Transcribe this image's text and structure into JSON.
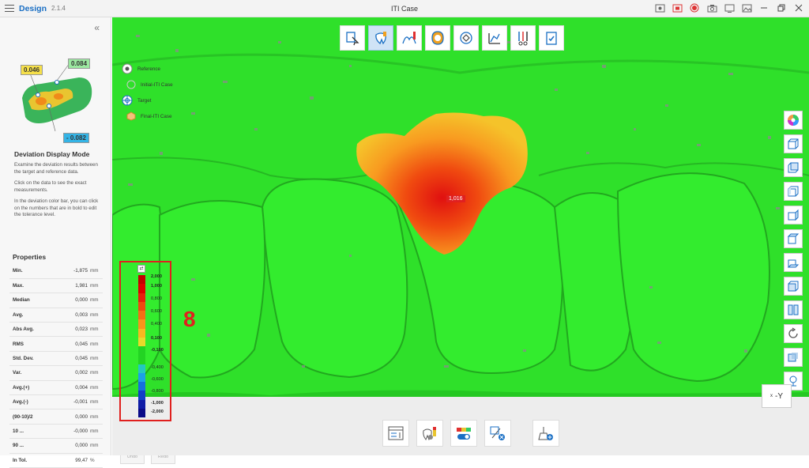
{
  "app": {
    "name": "Design",
    "version": "2.1.4",
    "window_title": "ITI Case"
  },
  "titlebar_icons": [
    "capture-icon",
    "record-frame-icon",
    "record-icon",
    "camera-icon",
    "screen-icon",
    "image-icon",
    "minimize-icon",
    "restore-icon",
    "close-icon"
  ],
  "thumbnail": {
    "tags": [
      "0.046",
      "0.084",
      "- 0.082"
    ]
  },
  "mode": {
    "title": "Deviation Display Mode",
    "paragraphs": [
      "Examine the deviation results between the target and reference data.",
      "Click on the data to see the exact measurements.",
      "In the deviation color bar, you can click on the numbers that are in bold to edit the tolerance level."
    ]
  },
  "properties": {
    "title": "Properties",
    "rows": [
      {
        "key": "Min.",
        "value": "-1,875",
        "unit": "mm"
      },
      {
        "key": "Max.",
        "value": "1,981",
        "unit": "mm"
      },
      {
        "key": "Median",
        "value": "0,000",
        "unit": "mm"
      },
      {
        "key": "Avg.",
        "value": "0,003",
        "unit": "mm"
      },
      {
        "key": "Abs Avg.",
        "value": "0,023",
        "unit": "mm"
      },
      {
        "key": "RMS",
        "value": "0,045",
        "unit": "mm"
      },
      {
        "key": "Std. Dev.",
        "value": "0,045",
        "unit": "mm"
      },
      {
        "key": "Var.",
        "value": "0,002",
        "unit": "mm"
      },
      {
        "key": "Avg.(+)",
        "value": "0,004",
        "unit": "mm"
      },
      {
        "key": "Avg.(-)",
        "value": "-0,001",
        "unit": "mm"
      },
      {
        "key": "(90-10)/2",
        "value": "0,000",
        "unit": "mm"
      },
      {
        "key": "10 ...",
        "value": "-0,000",
        "unit": "mm"
      },
      {
        "key": "90 ...",
        "value": "0,000",
        "unit": "mm"
      },
      {
        "key": "In Tol.",
        "value": "99,47",
        "unit": "%"
      }
    ]
  },
  "history": {
    "undo": "Undo",
    "redo": "Redo"
  },
  "legend": {
    "reference_label": "Reference",
    "reference_item": "Initial-ITI Case",
    "target_label": "Target",
    "target_item": "Final-ITI Case"
  },
  "colorbar": {
    "labels": [
      {
        "text": "2,000",
        "bold": true
      },
      {
        "text": "1,000",
        "bold": true
      },
      {
        "text": "0,800",
        "bold": false
      },
      {
        "text": "0,600",
        "bold": false
      },
      {
        "text": "0,400",
        "bold": false
      },
      {
        "text": "0,100",
        "bold": true
      },
      {
        "text": "-0,100",
        "bold": true
      },
      {
        "text": "-0,400",
        "bold": false
      },
      {
        "text": "-0,600",
        "bold": false
      },
      {
        "text": "-0,800",
        "bold": false
      },
      {
        "text": "-1,000",
        "bold": true
      },
      {
        "text": "-2,000",
        "bold": true
      }
    ],
    "colors": [
      "#c40000",
      "#e00000",
      "#e8200c",
      "#ee4a10",
      "#f37015",
      "#f7951b",
      "#f8b820",
      "#e9d92a",
      "#23d423",
      "#23d423",
      "#24c7c0",
      "#1da0e6",
      "#1670dc",
      "#1240c8",
      "#0f1ca6",
      "#0a0a88"
    ]
  },
  "annotation_step": "8",
  "deviation_point": "1,016",
  "view_cube": {
    "label": "-Y",
    "small": "x"
  },
  "accent_color": "#1a6fc4",
  "highlight_color": "#e0201e"
}
